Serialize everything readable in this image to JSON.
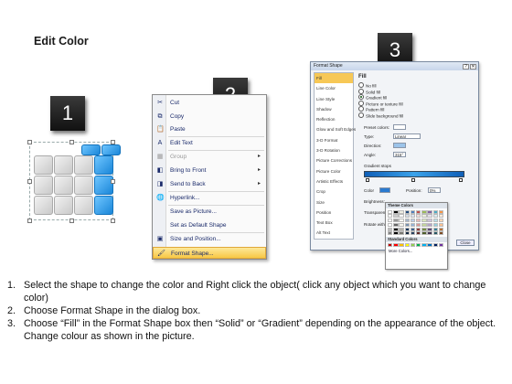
{
  "title": "Edit Color",
  "steps_badges": [
    "1",
    "2",
    "3"
  ],
  "context_menu": {
    "items": [
      {
        "icon": "scissors-icon",
        "glyph": "✂",
        "label": "Cut",
        "disabled": false,
        "submenu": false
      },
      {
        "icon": "copy-icon",
        "glyph": "⧉",
        "label": "Copy",
        "disabled": false,
        "submenu": false
      },
      {
        "icon": "paste-icon",
        "glyph": "📋",
        "label": "Paste",
        "disabled": false,
        "submenu": false
      },
      {
        "icon": "edit-text-icon",
        "glyph": "A",
        "label": "Edit Text",
        "disabled": false,
        "submenu": false
      },
      {
        "icon": "group-icon",
        "glyph": "▦",
        "label": "Group",
        "disabled": true,
        "submenu": true
      },
      {
        "icon": "bring-front-icon",
        "glyph": "◧",
        "label": "Bring to Front",
        "disabled": false,
        "submenu": true
      },
      {
        "icon": "send-back-icon",
        "glyph": "◨",
        "label": "Send to Back",
        "disabled": false,
        "submenu": true
      },
      {
        "icon": "hyperlink-icon",
        "glyph": "🌐",
        "label": "Hyperlink...",
        "disabled": false,
        "submenu": false
      },
      {
        "icon": "",
        "glyph": "",
        "label": "Save as Picture...",
        "disabled": false,
        "submenu": false
      },
      {
        "icon": "",
        "glyph": "",
        "label": "Set as Default Shape",
        "disabled": false,
        "submenu": false
      },
      {
        "icon": "size-position-icon",
        "glyph": "▣",
        "label": "Size and Position...",
        "disabled": false,
        "submenu": false
      },
      {
        "icon": "format-shape-icon",
        "glyph": "🖌",
        "label": "Format Shape...",
        "disabled": false,
        "submenu": false,
        "highlighted": true
      }
    ]
  },
  "format_dialog": {
    "title": "Format Shape",
    "left_items": [
      "Fill",
      "Line Color",
      "Line Style",
      "Shadow",
      "Reflection",
      "Glow and Soft Edges",
      "3-D Format",
      "3-D Rotation",
      "Picture Corrections",
      "Picture Color",
      "Artistic Effects",
      "Crop",
      "Size",
      "Position",
      "Text Box",
      "Alt Text"
    ],
    "selected_left": "Fill",
    "section_title": "Fill",
    "fill_options": [
      {
        "label": "No fill",
        "on": false
      },
      {
        "label": "Solid fill",
        "on": false
      },
      {
        "label": "Gradient fill",
        "on": true
      },
      {
        "label": "Picture or texture fill",
        "on": false
      },
      {
        "label": "Pattern fill",
        "on": false
      },
      {
        "label": "Slide background fill",
        "on": false
      }
    ],
    "preset_colors_label": "Preset colors:",
    "type_label": "Type:",
    "type_value": "Linear",
    "direction_label": "Direction:",
    "angle_label": "Angle:",
    "angle_value": "315°",
    "gradient_stops_label": "Gradient stops",
    "color_label": "Color",
    "position_label": "Position:",
    "position_value": "0%",
    "brightness_label": "Brightness:",
    "transparency_label": "Transparency:",
    "rotate_label": "Rotate with shape",
    "close_label": "Close"
  },
  "palette": {
    "theme_title": "Theme Colors",
    "standard_title": "Standard Colors",
    "more_label": "More Colors...",
    "theme_row": [
      "#ffffff",
      "#000000",
      "#eeece1",
      "#1f497d",
      "#4f81bd",
      "#c0504d",
      "#9bbb59",
      "#8064a2",
      "#4bacc6",
      "#f79646"
    ],
    "standard_row": [
      "#c00000",
      "#ff0000",
      "#ffc000",
      "#ffff00",
      "#92d050",
      "#00b050",
      "#00b0f0",
      "#0070c0",
      "#002060",
      "#7030a0"
    ]
  },
  "instructions": [
    {
      "n": "1.",
      "text": "Select the shape to change the color and Right click the object( click any object which you want to change color)"
    },
    {
      "n": "2.",
      "text": "Choose Format Shape in the dialog box."
    },
    {
      "n": "3.",
      "text": "Choose “Fill” in the Format Shape box then “Solid” or “Gradient” depending on the appearance of the object. Change colour as shown in the picture."
    }
  ]
}
